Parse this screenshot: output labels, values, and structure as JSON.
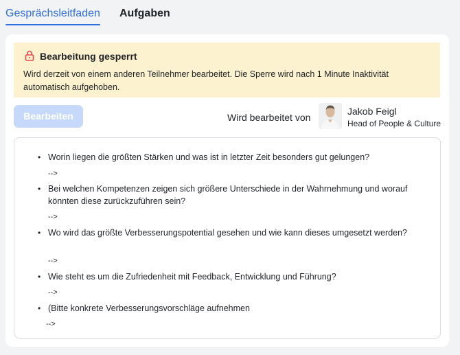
{
  "tabs": [
    {
      "label": "Gesprächsleitfaden",
      "active": true
    },
    {
      "label": "Aufgaben",
      "active": false
    }
  ],
  "lock_banner": {
    "title": "Bearbeitung gesperrt",
    "message": "Wird derzeit von einem anderen Teilnehmer bearbeitet. Die Sperre wird nach 1 Minute Inaktivität automatisch aufgehoben.",
    "icon": "lock-icon"
  },
  "toolbar": {
    "edit_label": "Bearbeiten",
    "edited_by_label": "Wird bearbeitet von"
  },
  "editor": {
    "name": "Jakob Feigl",
    "role": "Head of People & Culture"
  },
  "content": {
    "items": [
      {
        "text": "Worin liegen die größten Stärken und was ist in letzter Zeit besonders gut gelungen?",
        "arrow": "-->"
      },
      {
        "text": "Bei welchen Kompetenzen zeigen sich größere Unterschiede in der Wahrnehmung und worauf könnten diese zurückzuführen sein?",
        "arrow": "-->"
      },
      {
        "text": "Wo wird das größte Verbesserungspotential gesehen und wie kann dieses umgesetzt werden?",
        "arrow": "-->"
      },
      {
        "text": "Wie steht es um die Zufriedenheit mit Feedback, Entwicklung und Führung?",
        "arrow": "-->"
      },
      {
        "text": "(Bitte konkrete Verbesserungsvorschläge aufnehmen",
        "arrow": "-->"
      }
    ]
  },
  "colors": {
    "accent": "#2f6fde",
    "banner_bg": "#fcf2cf",
    "lock_red": "#e5484d",
    "button_disabled": "#c7d9fb"
  }
}
